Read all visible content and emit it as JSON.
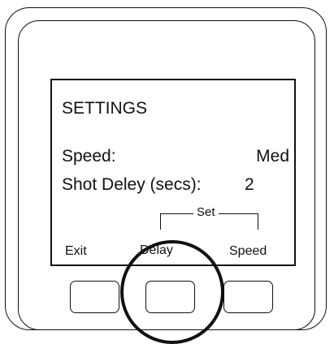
{
  "screen": {
    "title": "SETTINGS",
    "speed_label": "Speed:",
    "speed_value": "Med",
    "delay_label": "Shot Deley (secs):",
    "delay_value": "2"
  },
  "softkeys": {
    "group_label": "Set",
    "left": "Exit",
    "middle": "Delay",
    "right": "Speed"
  },
  "highlight": {
    "target": "middle-button"
  }
}
